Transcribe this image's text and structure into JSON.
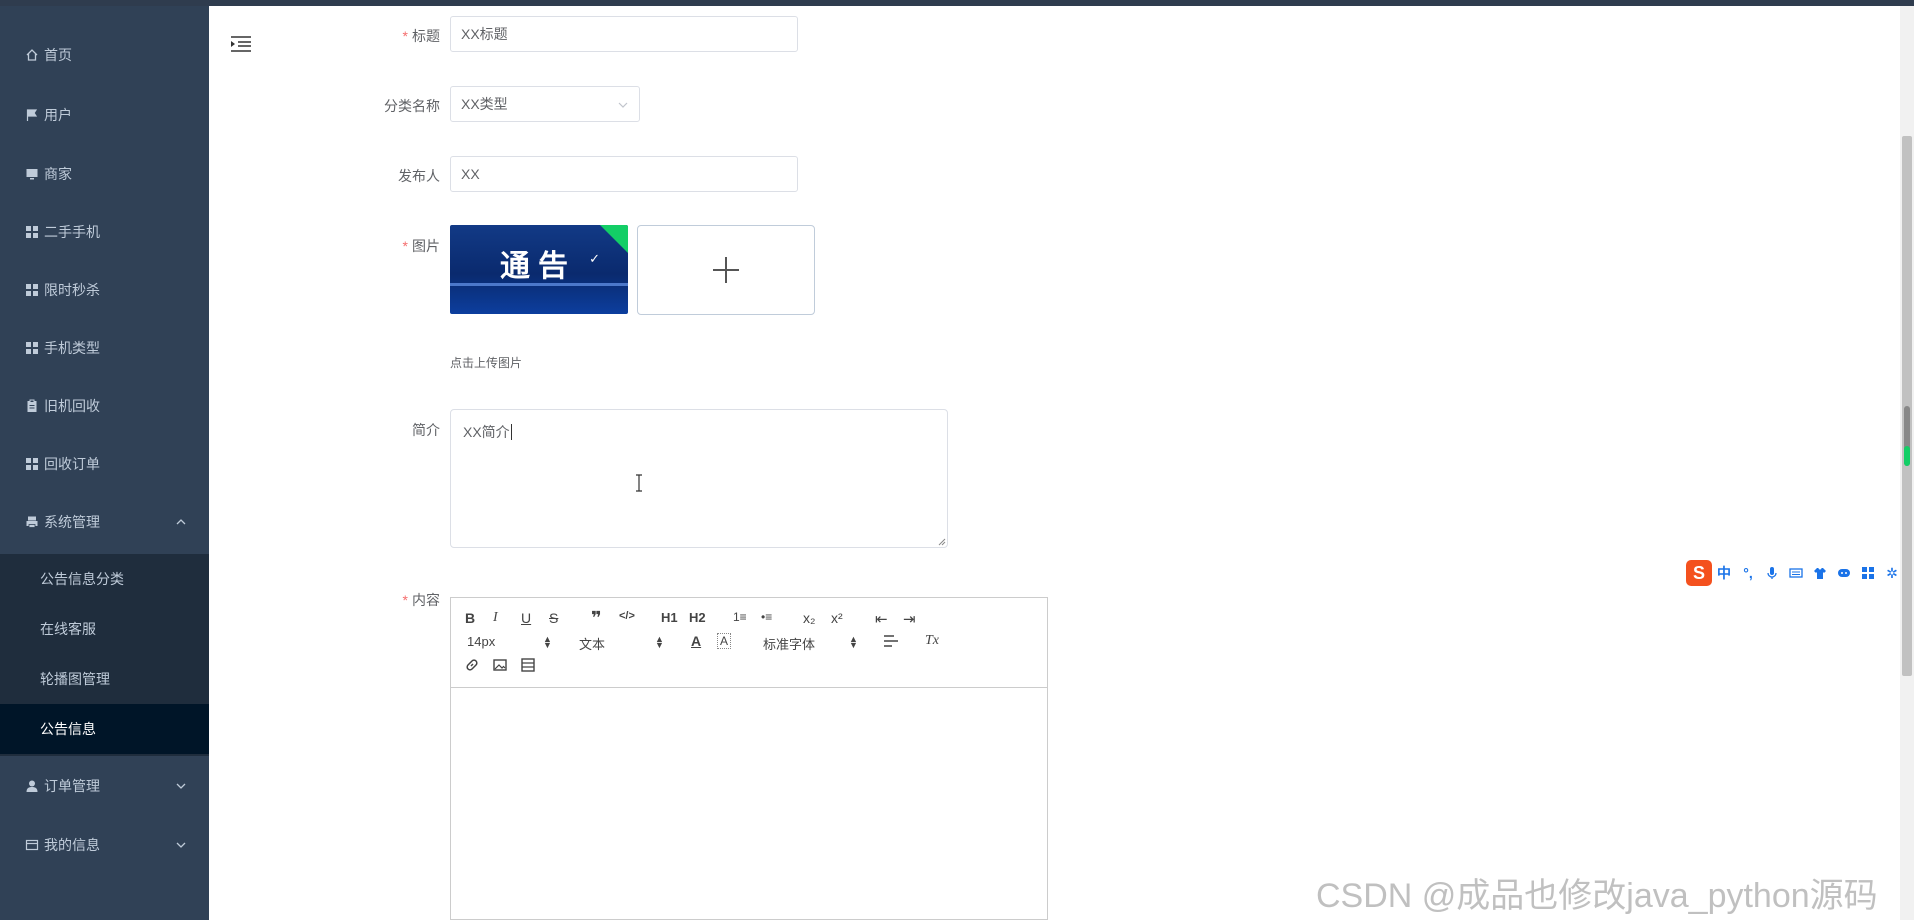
{
  "sidebar": {
    "items": [
      {
        "label": "首页",
        "icon": "home-icon"
      },
      {
        "label": "用户",
        "icon": "flag-icon"
      },
      {
        "label": "商家",
        "icon": "monitor-icon"
      },
      {
        "label": "二手手机",
        "icon": "grid-icon"
      },
      {
        "label": "限时秒杀",
        "icon": "grid-icon"
      },
      {
        "label": "手机类型",
        "icon": "grid-icon"
      },
      {
        "label": "旧机回收",
        "icon": "clipboard-icon"
      },
      {
        "label": "回收订单",
        "icon": "grid-icon"
      },
      {
        "label": "系统管理",
        "icon": "printer-icon"
      },
      {
        "label": "订单管理",
        "icon": "user-icon"
      },
      {
        "label": "我的信息",
        "icon": "wallet-icon"
      }
    ],
    "submenu": [
      {
        "label": "公告信息分类"
      },
      {
        "label": "在线客服"
      },
      {
        "label": "轮播图管理"
      },
      {
        "label": "公告信息"
      }
    ]
  },
  "form": {
    "title": {
      "label": "标题",
      "value": "XX标题"
    },
    "category": {
      "label": "分类名称",
      "value": "XX类型"
    },
    "publisher": {
      "label": "发布人",
      "value": "XX"
    },
    "image": {
      "label": "图片",
      "thumb_text": "通告",
      "tip": "点击上传图片"
    },
    "intro": {
      "label": "简介",
      "value": "XX简介"
    },
    "content": {
      "label": "内容"
    }
  },
  "editor": {
    "toolbar_row1": [
      "B",
      "I",
      "U",
      "S",
      "❞",
      "</>",
      "H1",
      "H2",
      "1≡",
      "•≡",
      "x₂",
      "x²",
      "⇤",
      "⇥"
    ],
    "size_select": "14px",
    "text_select": "文本",
    "font_select": "标准字体",
    "clear_format": "Tx"
  },
  "ime": {
    "label": "中"
  },
  "watermark": "CSDN @成品也修改java_python源码",
  "colors": {
    "sidebar": "#304156",
    "submenu": "#1f2d3d",
    "active": "#001528",
    "required": "#f56c6c"
  }
}
